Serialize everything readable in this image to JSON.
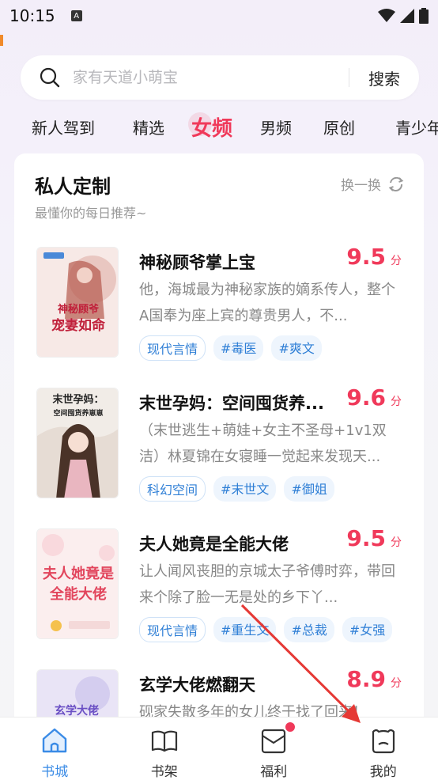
{
  "status_bar": {
    "time": "10:15",
    "notification_icon": "A"
  },
  "search": {
    "placeholder": "家有天道小萌宝",
    "button_label": "搜索"
  },
  "tabs": [
    {
      "label": "新人驾到",
      "active": false
    },
    {
      "label": "精选",
      "active": false
    },
    {
      "label": "女频",
      "active": true
    },
    {
      "label": "男频",
      "active": false
    },
    {
      "label": "原创",
      "active": false
    },
    {
      "label": "青少年",
      "active": false
    }
  ],
  "section": {
    "title": "私人定制",
    "subtitle": "最懂你的每日推荐~",
    "refresh_label": "换一换"
  },
  "books": [
    {
      "title": "神秘顾爷掌上宝",
      "score": "9.5",
      "score_unit": "分",
      "description": "他，海城最为神秘家族的嫡系传人，整个A国奉为座上宾的尊贵男人，不...",
      "tags": [
        "现代言情",
        "#毒医",
        "#爽文"
      ],
      "cover_text": "神秘顾爷宠妻如命"
    },
    {
      "title": "末世孕妈：空间囤货养...",
      "score": "9.6",
      "score_unit": "分",
      "description": "（末世逃生+萌娃+女主不圣母+1v1双洁）林夏锦在女寝睡一觉起来发现天...",
      "tags": [
        "科幻空间",
        "#末世文",
        "#御姐"
      ],
      "cover_text": "末世孕妈：空间囤货养崽崽"
    },
    {
      "title": "夫人她竟是全能大佬",
      "score": "9.5",
      "score_unit": "分",
      "description": "让人闻风丧胆的京城太子爷傅时弈，带回来个除了脸一无是处的乡下丫...",
      "tags": [
        "现代言情",
        "#重生文",
        "#总裁",
        "#女强"
      ],
      "cover_text": "夫人她竟是全能大佬"
    },
    {
      "title": "玄学大佬燃翻天",
      "score": "8.9",
      "score_unit": "分",
      "description": "砚家失散多年的女儿终于找了回来！",
      "tags": [],
      "cover_text": "玄学大佬"
    }
  ],
  "bottom_nav": [
    {
      "label": "书城",
      "icon": "home-icon",
      "active": true
    },
    {
      "label": "书架",
      "icon": "book-icon",
      "active": false
    },
    {
      "label": "福利",
      "icon": "envelope-icon",
      "active": false,
      "badge": true
    },
    {
      "label": "我的",
      "icon": "bear-face-icon",
      "active": false
    }
  ],
  "colors": {
    "accent": "#f0395a",
    "nav_active": "#3a8be6",
    "tag_text": "#2f7fd6"
  }
}
